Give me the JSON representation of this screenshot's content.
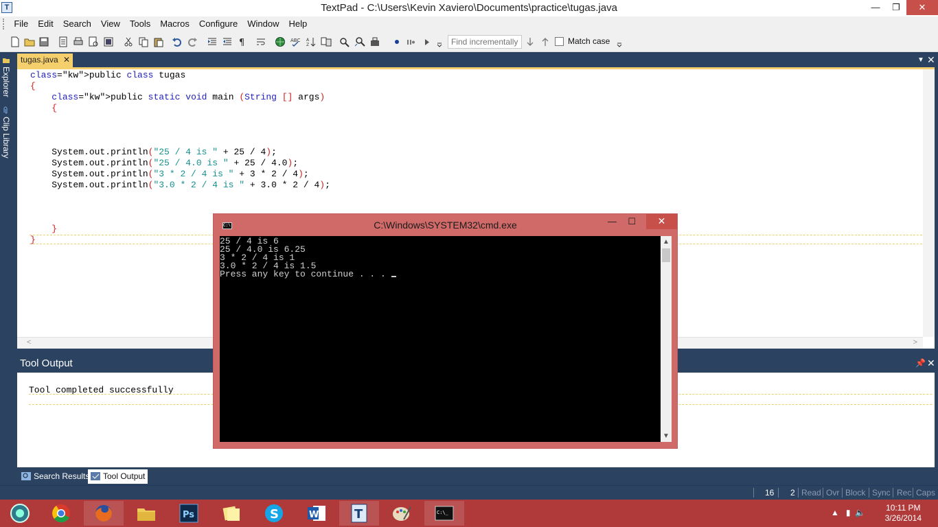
{
  "window": {
    "title": "TextPad - C:\\Users\\Kevin Xaviero\\Documents\\practice\\tugas.java",
    "app_icon": "T",
    "minimize": "—",
    "maximize": "❐",
    "close": "✕"
  },
  "menu": [
    "File",
    "Edit",
    "Search",
    "View",
    "Tools",
    "Macros",
    "Configure",
    "Window",
    "Help"
  ],
  "toolbar": {
    "find_placeholder": "Find incrementally",
    "match_case": "Match case"
  },
  "side_tabs": [
    "Explorer",
    "Clip Library"
  ],
  "doc_tab": {
    "label": "tugas.java",
    "close": "✕"
  },
  "code_lines": [
    "public class tugas",
    "{",
    "    public static void main (String [] args)",
    "    {",
    "",
    "",
    "",
    "    System.out.println(\"25 / 4 is \" + 25 / 4);",
    "    System.out.println(\"25 / 4.0 is \" + 25 / 4.0);",
    "    System.out.println(\"3 * 2 / 4 is \" + 3 * 2 / 4);",
    "    System.out.println(\"3.0 * 2 / 4 is \" + 3.0 * 2 / 4);",
    "",
    "",
    "",
    "    }",
    "}"
  ],
  "tool_output": {
    "title": "Tool Output",
    "text": "Tool completed successfully"
  },
  "bottom_tabs": [
    "Search Results",
    "Tool Output"
  ],
  "status": {
    "line": "16",
    "col": "2",
    "flags": [
      "Read",
      "Ovr",
      "Block",
      "Sync",
      "Rec",
      "Caps"
    ]
  },
  "cmd": {
    "title": "C:\\Windows\\SYSTEM32\\cmd.exe",
    "output": [
      "25 / 4 is 6",
      "25 / 4.0 is 6.25",
      "3 * 2 / 4 is 1",
      "3.0 * 2 / 4 is 1.5",
      "Press any key to continue . . . "
    ]
  },
  "taskbar": {
    "apps": [
      "start-icon",
      "chrome-icon",
      "firefox-icon",
      "file-explorer-icon",
      "photoshop-icon",
      "sticky-notes-icon",
      "skype-icon",
      "word-icon",
      "textpad-icon",
      "paint-icon",
      "cmd-icon"
    ],
    "time": "10:11 PM",
    "date": "3/26/2014"
  },
  "colors": {
    "accent_tab": "#f5cf6b",
    "panel_bg": "#2b4260",
    "taskbar": "#b03a3a",
    "cmd_frame": "#d06a68",
    "keyword": "#2020c0",
    "string": "#159090",
    "brace": "#d02020"
  }
}
